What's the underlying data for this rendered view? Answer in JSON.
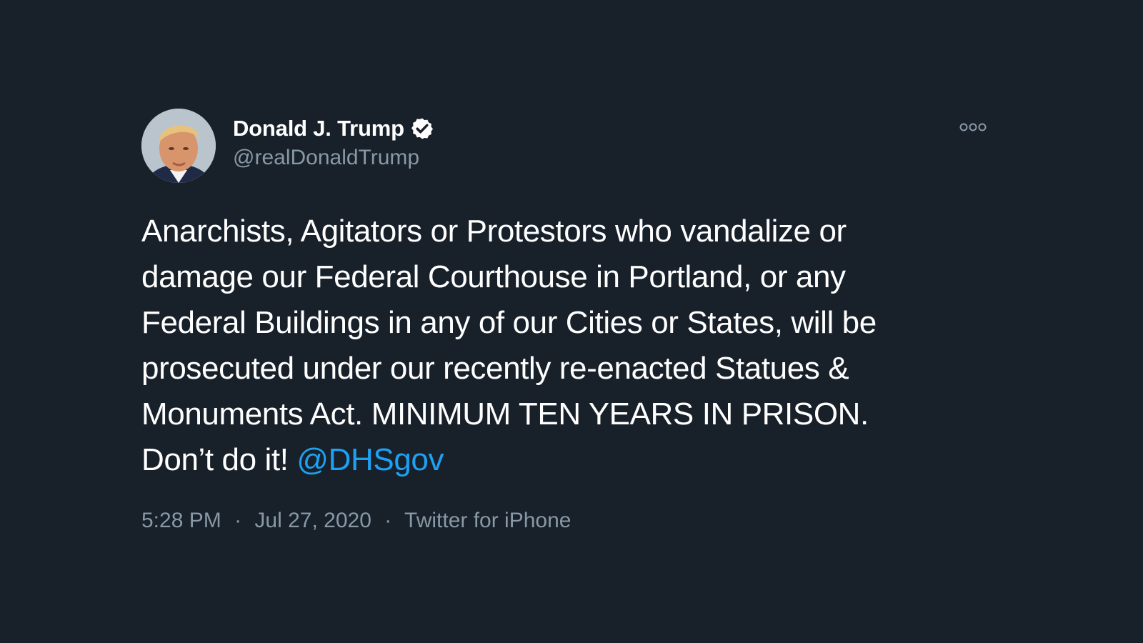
{
  "tweet": {
    "author": {
      "display_name": "Donald J. Trump",
      "handle": "@realDonaldTrump",
      "verified_icon": "verified-badge-icon",
      "avatar": "profile-photo"
    },
    "more_icon": "more-options-icon",
    "text_lines": [
      "Anarchists, Agitators or Protestors who vandalize or",
      "damage our Federal Courthouse in Portland, or any",
      "Federal Buildings in any of our Cities or States, will be",
      "prosecuted under our recently re-enacted Statues &",
      "Monuments Act. MINIMUM TEN YEARS IN PRISON."
    ],
    "last_line_text": "Don’t do it!",
    "mention": "@DHSgov",
    "time": "5:28 PM",
    "date": "Jul 27, 2020",
    "separator": "·",
    "source": "Twitter for iPhone"
  },
  "colors": {
    "background": "#18202a",
    "text": "#ffffff",
    "secondary": "#8899a6",
    "accent": "#1da1f2"
  }
}
